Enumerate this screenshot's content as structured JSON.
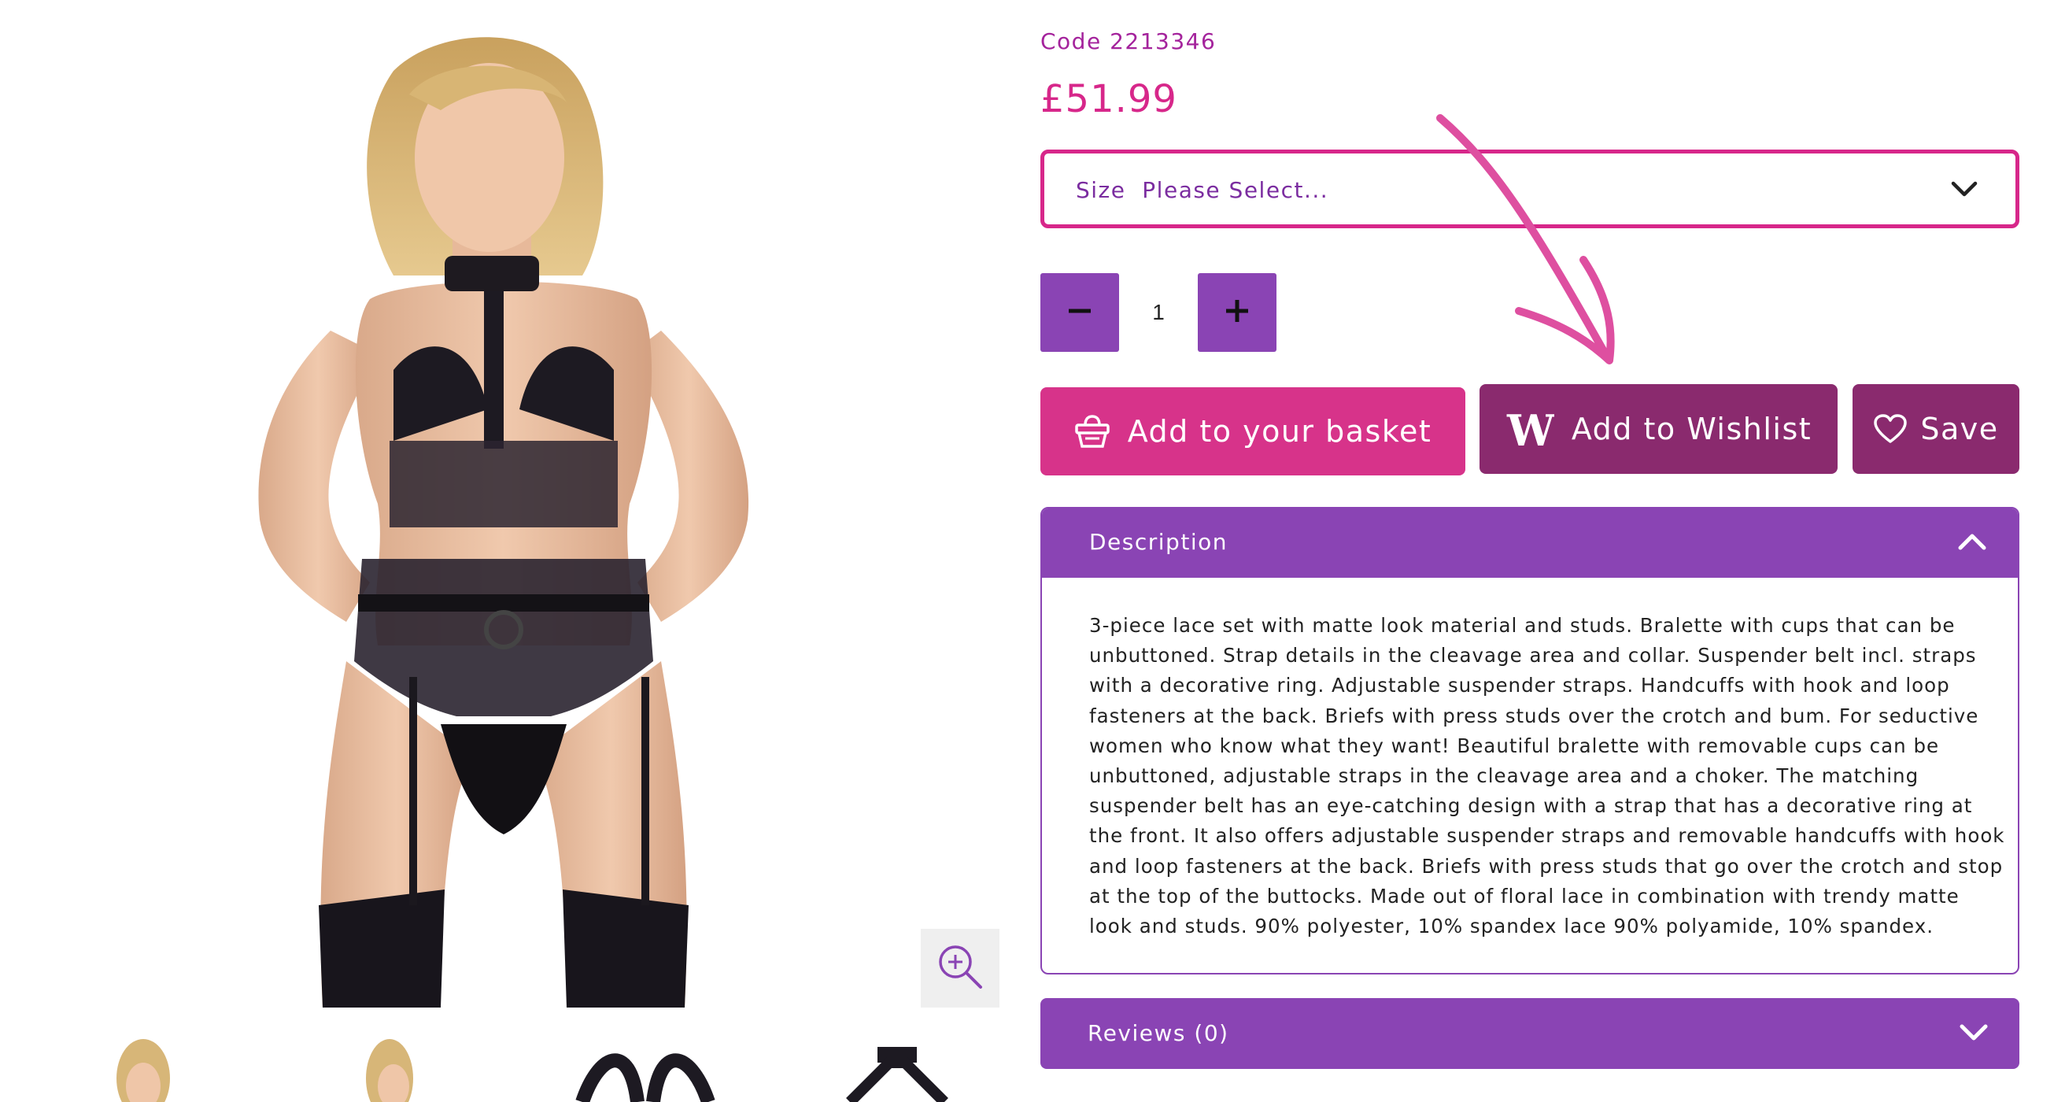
{
  "product": {
    "code": "Code 2213346",
    "price": "£51.99"
  },
  "size_select": {
    "label": "Size",
    "value": "Please Select..."
  },
  "quantity": {
    "value": "1"
  },
  "actions": {
    "basket_label": "Add to your basket",
    "wishlist_label": "Add to Wishlist",
    "save_label": "Save"
  },
  "description": {
    "title": "Description",
    "lines": [
      "3-piece lace set with matte look material and studs. Bralette with cups that can be",
      "unbuttoned. Strap details in the cleavage area and collar. Suspender belt incl. straps",
      "with a decorative ring. Adjustable suspender straps. Handcuffs with hook and loop",
      "fasteners at the back. Briefs with press studs over the crotch and bum. For seductive",
      "women who know what they want! Beautiful bralette with removable cups can be",
      "unbuttoned, adjustable straps in the cleavage area and a choker. The matching",
      "suspender belt has an eye-catching design with a strap that has a decorative ring at",
      "the front. It also offers adjustable suspender straps and removable handcuffs with hook",
      "and loop fasteners at the back. Briefs with press studs that go over the crotch and stop",
      "at the top of the buttocks. Made out of floral lace in combination with trendy matte",
      "look and studs. 90% polyester, 10% spandex lace 90% polyamide, 10% spandex."
    ]
  },
  "reviews": {
    "title": "Reviews (0)"
  },
  "icons": {
    "zoom": "zoom-in-icon",
    "size_chevron": "chevron-down-icon",
    "minus": "minus-icon",
    "plus": "plus-icon",
    "basket": "basket-icon",
    "wishlist": "wishlist-w-icon",
    "save": "heart-icon",
    "description_chevron": "chevron-up-icon",
    "reviews_chevron": "chevron-down-icon"
  },
  "colors": {
    "accent_pink": "#d7278a",
    "accent_purple": "#8a44b4",
    "dark_plum": "#8a2a6e",
    "code_text": "#a4239c"
  }
}
